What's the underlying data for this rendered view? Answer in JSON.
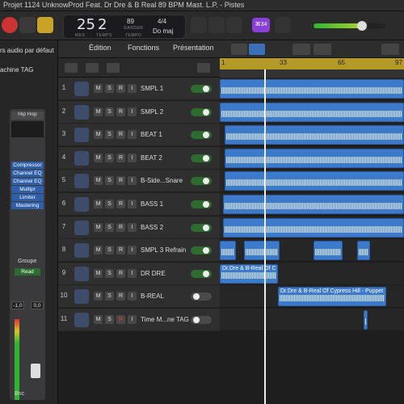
{
  "window": {
    "title": "Projet 1124 UnknowProd Feat. Dr Dre & B Real 89 BPM Mast. L.P. - Pistes"
  },
  "lcd": {
    "bars": "25",
    "beats": "2",
    "bars_label": "MES",
    "beats_label": "TEMPS",
    "tempo": "89",
    "tempo_label": "GARDER",
    "tempo_sub_label": "TEMPO",
    "signature": "4/4",
    "key": "Do maj"
  },
  "counter_badge": "⌘34",
  "toolbar": {
    "edit": "Édition",
    "functions": "Fonctions",
    "view": "Présentation"
  },
  "inspector": {
    "line1": "rs audio par défaut",
    "line2": "achine TAG",
    "eq_label": "Hip Hop",
    "plugins": [
      "Compressor",
      "Channel EQ",
      "Channel EQ",
      "Multipr",
      "Limiter",
      "Mastering"
    ],
    "group": "Groupe",
    "automation": "Read",
    "gain": "-1,0",
    "pan": "0,0",
    "bounce": "Bnc"
  },
  "ruler": {
    "marks": [
      "1",
      "33",
      "65",
      "97"
    ]
  },
  "tracks": [
    {
      "num": "1",
      "name": "SMPL 1",
      "icon": "pencil-icon",
      "on": true
    },
    {
      "num": "2",
      "name": "SMPL 2",
      "icon": "pencil-icon",
      "on": true
    },
    {
      "num": "3",
      "name": "BEAT 1",
      "icon": "drum-icon",
      "on": true
    },
    {
      "num": "4",
      "name": "BEAT 2",
      "icon": "drum-icon",
      "on": true
    },
    {
      "num": "5",
      "name": "B-Side...Snare",
      "icon": "snare-icon",
      "on": true
    },
    {
      "num": "6",
      "name": "BASS 1",
      "icon": "bass-icon",
      "on": true
    },
    {
      "num": "7",
      "name": "BASS 2",
      "icon": "bass-icon",
      "on": true
    },
    {
      "num": "8",
      "name": "SMPL 3 Refrain",
      "icon": "pencil-icon",
      "on": true
    },
    {
      "num": "9",
      "name": "DR DRE",
      "icon": "pencil-icon",
      "on": true
    },
    {
      "num": "10",
      "name": "B-REAL",
      "icon": "pencil-icon",
      "on": false
    },
    {
      "num": "11",
      "name": "Time M...ne TAG",
      "icon": "star-icon",
      "on": false
    }
  ],
  "regions": {
    "dre": "Dr.Dre & B-Real Of C",
    "breal": "Dr.Dre & B-Real Of Cypress Hill - Puppet"
  },
  "msr": {
    "m": "M",
    "s": "S",
    "r": "R",
    "i": "I"
  },
  "colors": {
    "region": "#3d7acb",
    "ruler": "#b59a2a",
    "toggle_on": "#2e6b2e",
    "badge": "#8a3fd6"
  }
}
